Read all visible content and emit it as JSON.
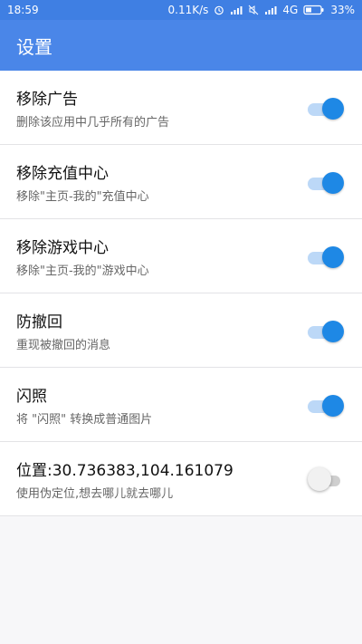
{
  "colors": {
    "status_bar": "#3f7fe3",
    "app_bar": "#4a86e8",
    "switch_on": "#1e88e5"
  },
  "status_bar": {
    "time": "18:59",
    "network_speed": "0.11K/s",
    "network_type": "4G",
    "battery": "33%",
    "icons": [
      "alarm-icon",
      "signal-icon",
      "mute-icon",
      "signal-icon",
      "battery-icon"
    ]
  },
  "app_bar": {
    "title": "设置"
  },
  "settings": [
    {
      "title": "移除广告",
      "subtitle": "删除该应用中几乎所有的广告",
      "enabled": true
    },
    {
      "title": "移除充值中心",
      "subtitle": "移除\"主页-我的\"充值中心",
      "enabled": true
    },
    {
      "title": "移除游戏中心",
      "subtitle": "移除\"主页-我的\"游戏中心",
      "enabled": true
    },
    {
      "title": "防撤回",
      "subtitle": "重现被撤回的消息",
      "enabled": true
    },
    {
      "title": "闪照",
      "subtitle": "将 \"闪照\" 转换成普通图片",
      "enabled": true
    },
    {
      "title": "位置:30.736383,104.161079",
      "subtitle": "使用伪定位,想去哪儿就去哪儿",
      "enabled": false
    }
  ]
}
